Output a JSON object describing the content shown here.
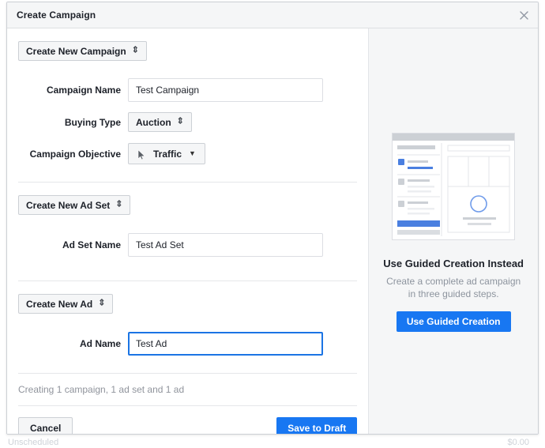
{
  "window": {
    "title": "Create Campaign",
    "close_icon": "close-icon"
  },
  "colors": {
    "primary": "#1877f2",
    "focus_border": "#1b74e4",
    "titlebar_bg": "#f5f6f7",
    "panel_bg": "#f5f6f7",
    "text": "#1d2129",
    "muted_text": "#90949c"
  },
  "campaign_section": {
    "selector_label": "Create New Campaign",
    "selector_glyph": "⇕",
    "fields": [
      {
        "label": "Campaign Name",
        "value": "Test Campaign",
        "placeholder": "Campaign Name"
      }
    ],
    "buying_type": {
      "label": "Buying Type",
      "value": "Auction",
      "glyph": "⇕"
    },
    "objective": {
      "label": "Campaign Objective",
      "value": "Traffic",
      "glyph": "▼",
      "cursor_icon": "mouse-pointer-icon"
    }
  },
  "adset_section": {
    "selector_label": "Create New Ad Set",
    "selector_glyph": "⇕",
    "fields": [
      {
        "label": "Ad Set Name",
        "value": "Test Ad Set",
        "placeholder": "Ad Set Name"
      }
    ]
  },
  "ad_section": {
    "selector_label": "Create New Ad",
    "selector_glyph": "⇕",
    "fields": [
      {
        "label": "Ad Name",
        "value": "Test Ad",
        "placeholder": "Ad Name"
      }
    ]
  },
  "summary": {
    "text": "Creating 1 campaign, 1 ad set and 1 ad"
  },
  "footer": {
    "cancel_label": "Cancel",
    "save_label": "Save to Draft"
  },
  "promo": {
    "illustration_icon": "guided-creation-illustration",
    "title": "Use Guided Creation Instead",
    "description": "Create a complete ad campaign in three guided steps.",
    "button_label": "Use Guided Creation"
  },
  "background": {
    "left_cell": "Unscheduled",
    "right_cell": "$0.00"
  }
}
